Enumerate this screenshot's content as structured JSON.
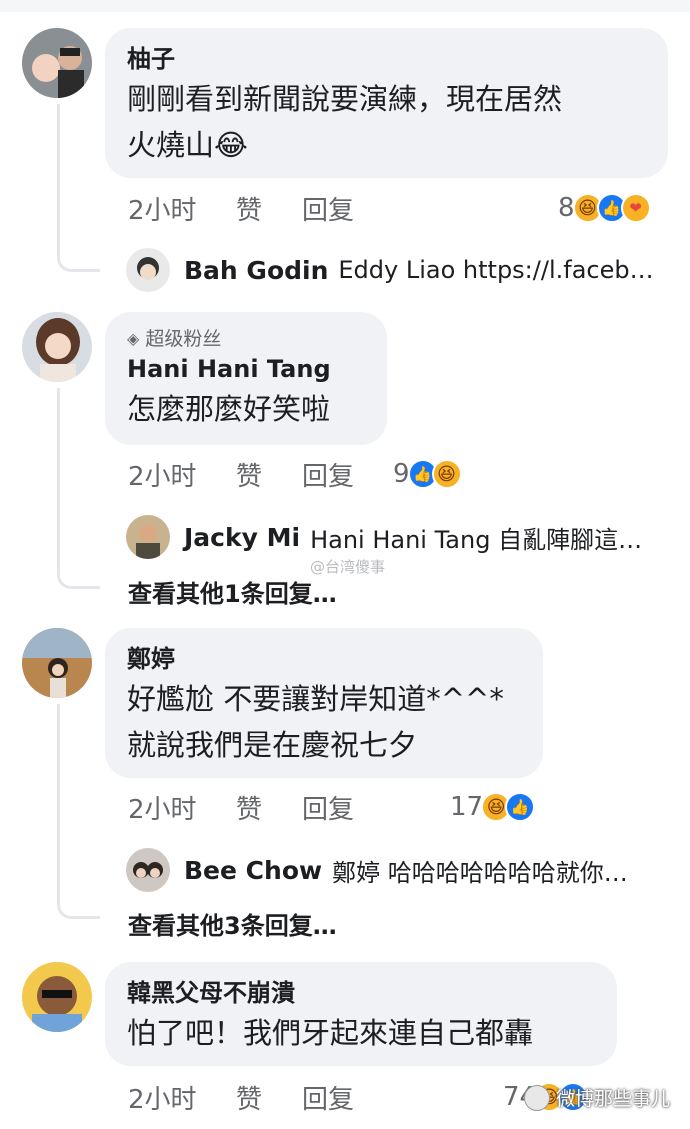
{
  "comments": [
    {
      "author": "柚子",
      "lines": [
        "剛剛看到新聞說要演練，現在居然",
        "火燒山😂"
      ],
      "time": "2小时",
      "like": "赞",
      "reply": "回复",
      "reaction_count": "8",
      "reactions": [
        "haha-reaction-icon",
        "like-reaction-icon",
        "care-reaction-icon"
      ],
      "reply_preview": {
        "name": "Bah Godin",
        "text": "Eddy Liao https://l.faceb…"
      }
    },
    {
      "badge": "超级粉丝",
      "author": "Hani Hani Tang",
      "lines": [
        "怎麼那麼好笑啦"
      ],
      "time": "2小时",
      "like": "赞",
      "reply": "回复",
      "reaction_count": "9",
      "reactions": [
        "like-reaction-icon",
        "haha-reaction-icon"
      ],
      "reply_preview": {
        "name": "Jacky Mi",
        "text": "Hani Hani Tang 自亂陣腳這…"
      },
      "more_replies": "查看其他1条回复…"
    },
    {
      "author": "鄭婷",
      "lines": [
        "好尷尬 不要讓對岸知道*^^*",
        "就說我們是在慶祝七夕"
      ],
      "time": "2小时",
      "like": "赞",
      "reply": "回复",
      "reaction_count": "17",
      "reactions": [
        "haha-reaction-icon",
        "like-reaction-icon"
      ],
      "reply_preview": {
        "name": "Bee Chow",
        "text": "鄭婷 哈哈哈哈哈哈哈就你…"
      },
      "more_replies": "查看其他3条回复…"
    },
    {
      "author": "韓黑父母不崩潰",
      "lines": [
        "怕了吧！我們牙起來連自己都轟"
      ],
      "time": "2小时",
      "like": "赞",
      "reply": "回复",
      "reaction_count": "74",
      "reactions": [
        "haha-reaction-icon",
        "like-reaction-icon"
      ]
    }
  ],
  "watermarks": {
    "middle": "@台湾傻事",
    "bottom": "微博那些事儿"
  },
  "colors": {
    "bubble": "#f0f2f5",
    "secondary_text": "#65676b",
    "like_blue": "#1877f2",
    "haha_yellow": "#f7b125"
  }
}
